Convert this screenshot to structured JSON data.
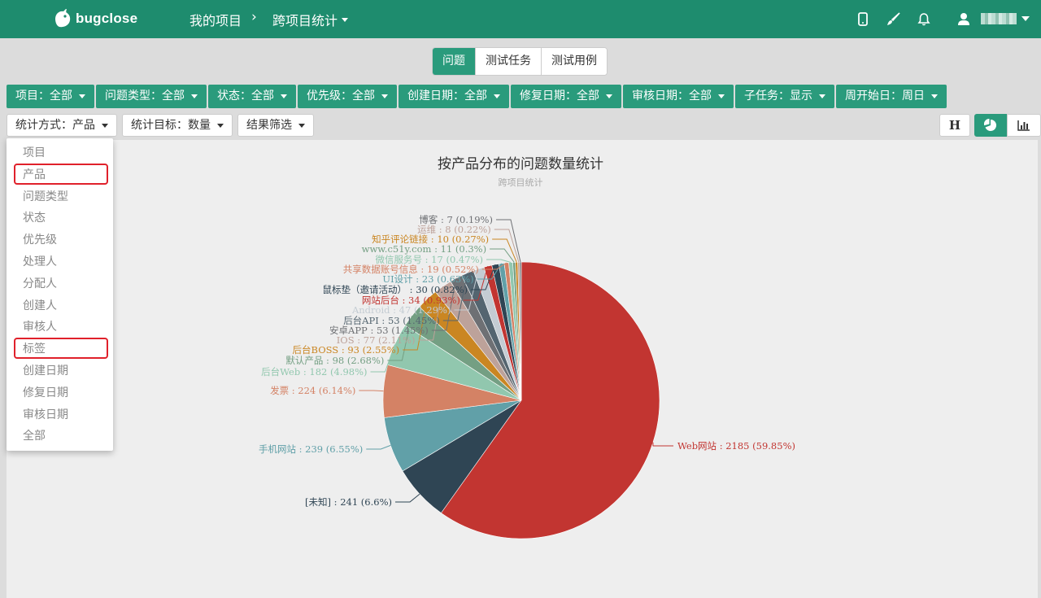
{
  "header": {
    "logo_text": "bugclose",
    "breadcrumb": [
      "我的项目",
      "跨项目统计"
    ],
    "icons": [
      "mobile-icon",
      "brush-icon",
      "bell-icon",
      "user-icon"
    ],
    "accent": "#1e8c6e"
  },
  "tabs": [
    {
      "label": "问题",
      "active": true
    },
    {
      "label": "测试任务",
      "active": false
    },
    {
      "label": "测试用例",
      "active": false
    }
  ],
  "filters": [
    "项目：全部",
    "问题类型：全部",
    "状态：全部",
    "优先级：全部",
    "创建日期：全部",
    "修复日期：全部",
    "审核日期：全部",
    "子任务：显示",
    "周开始日：周日"
  ],
  "options": [
    "统计方式：产品",
    "统计目标：数量",
    "结果筛选"
  ],
  "view_buttons": {
    "text_view": "H",
    "pie_view": "pie-chart-icon",
    "bar_view": "bar-chart-icon"
  },
  "menu": {
    "items": [
      "项目",
      "产品",
      "问题类型",
      "状态",
      "优先级",
      "处理人",
      "分配人",
      "创建人",
      "审核人",
      "标签",
      "创建日期",
      "修复日期",
      "审核日期",
      "全部"
    ],
    "highlighted": [
      "产品",
      "标签"
    ]
  },
  "chart_data": {
    "type": "pie",
    "title": "按产品分布的问题数量统计",
    "subtitle": "跨项目统计",
    "slices": [
      {
        "name": "Web网站",
        "value": 2185,
        "percent": "59.85%",
        "color": "#c23531"
      },
      {
        "name": "[未知]",
        "value": 241,
        "percent": "6.6%",
        "color": "#2f4554"
      },
      {
        "name": "手机网站",
        "value": 239,
        "percent": "6.55%",
        "color": "#61a0a8"
      },
      {
        "name": "发票",
        "value": 224,
        "percent": "6.14%",
        "color": "#d48265"
      },
      {
        "name": "后台Web",
        "value": 182,
        "percent": "4.98%",
        "color": "#91c7ae"
      },
      {
        "name": "默认产品",
        "value": 98,
        "percent": "2.68%",
        "color": "#749f83"
      },
      {
        "name": "后台BOSS",
        "value": 93,
        "percent": "2.55%",
        "color": "#ca8622"
      },
      {
        "name": "IOS",
        "value": 77,
        "percent": "2.11%",
        "color": "#bda29a"
      },
      {
        "name": "安卓APP",
        "value": 53,
        "percent": "1.45%",
        "color": "#6e7074"
      },
      {
        "name": "后台API",
        "value": 53,
        "percent": "1.45%",
        "color": "#546570"
      },
      {
        "name": "Android",
        "value": 47,
        "percent": "1.29%",
        "color": "#c4ccd3"
      },
      {
        "name": "网站后台",
        "value": 34,
        "percent": "0.93%",
        "color": "#c23531"
      },
      {
        "name": "鼠标垫（邀请活动）",
        "value": 30,
        "percent": "0.82%",
        "color": "#2f4554"
      },
      {
        "name": "UI设计",
        "value": 23,
        "percent": "0.63%",
        "color": "#61a0a8"
      },
      {
        "name": "共享数据账号信息",
        "value": 19,
        "percent": "0.52%",
        "color": "#d48265"
      },
      {
        "name": "微信服务号",
        "value": 17,
        "percent": "0.47%",
        "color": "#91c7ae"
      },
      {
        "name": "www.c51y.com",
        "value": 11,
        "percent": "0.3%",
        "color": "#749f83"
      },
      {
        "name": "知乎评论链接",
        "value": 10,
        "percent": "0.27%",
        "color": "#ca8622"
      },
      {
        "name": "运维",
        "value": 8,
        "percent": "0.22%",
        "color": "#bda29a"
      },
      {
        "name": "博客",
        "value": 7,
        "percent": "0.19%",
        "color": "#6e7074"
      }
    ]
  }
}
